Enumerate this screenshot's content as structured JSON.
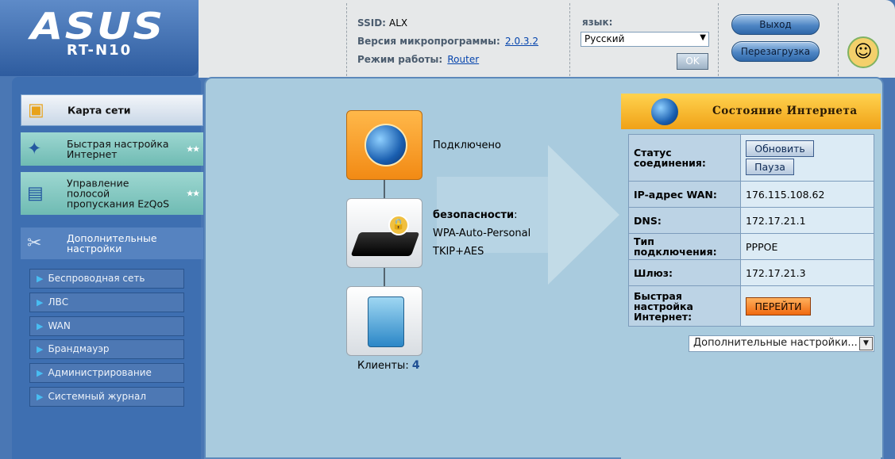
{
  "brand": {
    "logo": "ASUS",
    "model": "RT-N10"
  },
  "info": {
    "ssid_label": "SSID:",
    "ssid_value": "ALX",
    "firmware_label": "Версия микропрограммы:",
    "firmware_value": "2.0.3.2",
    "mode_label": "Режим работы:",
    "mode_value": "Router"
  },
  "language": {
    "label": "язык:",
    "selected": "Русский",
    "ok_label": "OK"
  },
  "actions": {
    "logout": "Выход",
    "reboot": "Перезагрузка"
  },
  "sidebar": {
    "items": [
      {
        "label": "Карта сети",
        "icon": "network-map-icon"
      },
      {
        "label": "Быстрая настройка Интернет",
        "icon": "magic-wand-icon"
      },
      {
        "label": "Управление полосой пропускания EzQoS",
        "icon": "bandwidth-icon"
      },
      {
        "label": "Дополнительные настройки",
        "icon": "tools-icon"
      }
    ],
    "subitems": [
      "Беспроводная сеть",
      "ЛВС",
      "WAN",
      "Брандмауэр",
      "Администрирование",
      "Системный журнал"
    ]
  },
  "map": {
    "internet_status": "Подключено",
    "security_label": "безопасности",
    "security_colon": ":",
    "security_mode": "WPA-Auto-Personal",
    "encryption": "TKIP+AES",
    "clients_label": "Клиенты:",
    "clients_count": "4"
  },
  "status": {
    "title": "Состояние Интернета",
    "connection_status_label": "Статус соединения:",
    "refresh_label": "Обновить",
    "pause_label": "Пауза",
    "wan_ip_label": "IP-адрес WAN:",
    "wan_ip": "176.115.108.62",
    "dns_label": "DNS:",
    "dns": "172.17.21.1",
    "conn_type_label": "Тип подключения:",
    "conn_type": "PPPOE",
    "gateway_label": "Шлюз:",
    "gateway": "172.17.21.3",
    "quick_setup_label": "Быстрая настройка Интернет:",
    "go_label": "ПЕРЕЙТИ",
    "advanced_select": "Дополнительные настройки..."
  },
  "colors": {
    "header_blue": "#3e6fb1",
    "panel_bg": "#a9cbde",
    "accent_orange": "#f28a14"
  }
}
